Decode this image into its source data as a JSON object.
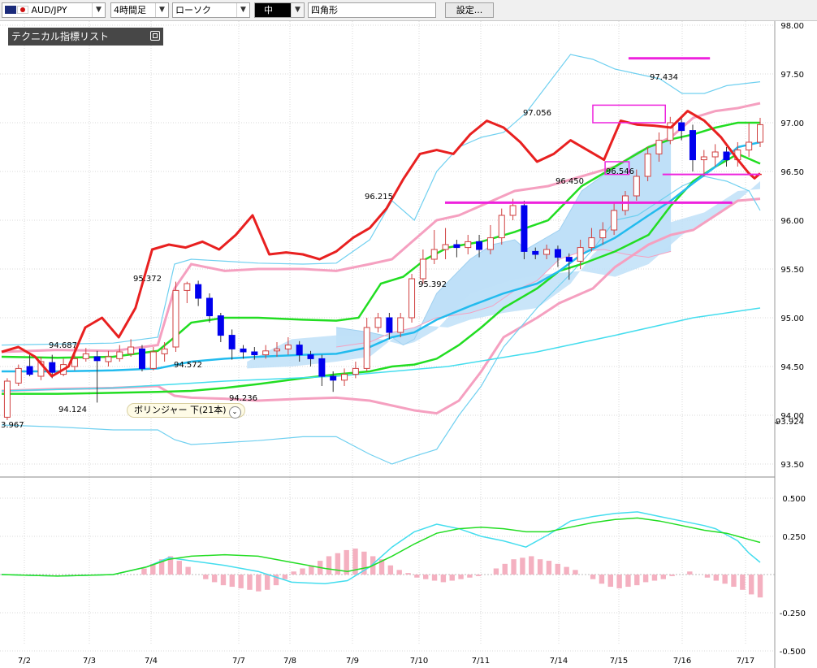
{
  "toolbar": {
    "symbol": "AUD/JPY",
    "timeframe": "4時間足",
    "chart_style": "ローソク",
    "size": "中",
    "drawing_tool": "四角形",
    "settings_label": "設定..."
  },
  "indicator_list_label": "テクニカル指標リスト",
  "bb_badge_label": "ボリンジャー 下(21本)",
  "colors": {
    "price_line": "#e82020",
    "ma_green": "#22dd22",
    "ma_blue": "#22bbee",
    "ma_light": "#44ddee",
    "bb_pink": "#f5a0c0",
    "bb_cyan": "#70d0f0",
    "magenta_marks": "#ee22dd",
    "cloud_fill": "#bfe0f8",
    "bull_candle": "#d04040",
    "bear_candle": "#0000ee",
    "histogram": "#f4b0c0"
  },
  "chart_data": [
    {
      "type": "candlestick",
      "title": "",
      "x_labels": [
        "7/2",
        "7/3",
        "7/4",
        "7/7",
        "7/8",
        "7/9",
        "7/10",
        "7/11",
        "7/14",
        "7/15",
        "7/16",
        "7/17"
      ],
      "y_ticks": [
        "98.00",
        "97.50",
        "97.00",
        "96.50",
        "96.00",
        "95.50",
        "95.00",
        "94.50",
        "94.00",
        "93.924",
        "93.50"
      ],
      "ylim": [
        93.4,
        98.0
      ],
      "grid": true,
      "annotations": [
        {
          "text": "3.967",
          "x": 1.0,
          "y": 93.967
        },
        {
          "text": "94.124",
          "x": 18.0,
          "y": 94.124
        },
        {
          "text": "94.687",
          "x": 16.0,
          "y": 94.687
        },
        {
          "text": "95.372",
          "x": 33.0,
          "y": 95.372
        },
        {
          "text": "94.572",
          "x": 45.0,
          "y": 94.572
        },
        {
          "text": "94.236",
          "x": 60.0,
          "y": 94.236
        },
        {
          "text": "96.215",
          "x": 94.0,
          "y": 96.215
        },
        {
          "text": "95.392",
          "x": 106.0,
          "y": 95.392
        },
        {
          "text": "97.056",
          "x": 132.0,
          "y": 97.056
        },
        {
          "text": "96.450",
          "x": 140.0,
          "y": 96.45
        },
        {
          "text": "96.546",
          "x": 156.0,
          "y": 96.546
        },
        {
          "text": "97.434",
          "x": 164.0,
          "y": 97.434
        }
      ],
      "price_line": [
        [
          0,
          94.65
        ],
        [
          3,
          94.7
        ],
        [
          6,
          94.6
        ],
        [
          9,
          94.4
        ],
        [
          12,
          94.5
        ],
        [
          15,
          94.9
        ],
        [
          18,
          95.0
        ],
        [
          21,
          94.8
        ],
        [
          24,
          95.1
        ],
        [
          27,
          95.7
        ],
        [
          30,
          95.75
        ],
        [
          33,
          95.72
        ],
        [
          36,
          95.78
        ],
        [
          39,
          95.7
        ],
        [
          42,
          95.85
        ],
        [
          45,
          96.05
        ],
        [
          48,
          95.65
        ],
        [
          51,
          95.67
        ],
        [
          54,
          95.65
        ],
        [
          57,
          95.6
        ],
        [
          60,
          95.68
        ],
        [
          63,
          95.82
        ],
        [
          66,
          95.92
        ],
        [
          69,
          96.12
        ],
        [
          72,
          96.42
        ],
        [
          75,
          96.68
        ],
        [
          78,
          96.72
        ],
        [
          81,
          96.68
        ],
        [
          84,
          96.88
        ],
        [
          87,
          97.02
        ],
        [
          90,
          96.95
        ],
        [
          93,
          96.8
        ],
        [
          96,
          96.6
        ],
        [
          99,
          96.68
        ],
        [
          102,
          96.82
        ],
        [
          105,
          96.72
        ],
        [
          108,
          96.62
        ],
        [
          111,
          97.02
        ],
        [
          114,
          96.98
        ],
        [
          117,
          96.97
        ],
        [
          120,
          96.95
        ],
        [
          123,
          97.12
        ],
        [
          126,
          97.02
        ],
        [
          129,
          96.85
        ],
        [
          132,
          96.62
        ],
        [
          134,
          96.48
        ],
        [
          135,
          96.43
        ],
        [
          136,
          96.48
        ]
      ],
      "series": [
        {
          "name": "",
          "color": "#e82020",
          "values": "price_line"
        }
      ]
    },
    {
      "type": "line",
      "title": "",
      "y_ticks": [
        "0.500",
        "0.250",
        "-0.250",
        "-0.500"
      ],
      "ylim": [
        -0.5,
        0.5
      ],
      "grid": true
    }
  ]
}
